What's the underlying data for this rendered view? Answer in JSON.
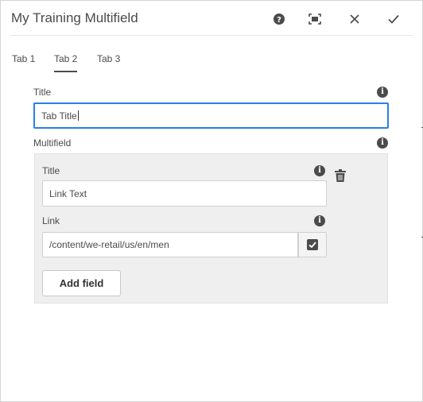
{
  "dialog": {
    "title": "My Training Multifield",
    "buttons": {
      "help": "help-icon",
      "fullscreen": "fullscreen-icon",
      "close": "close-icon",
      "done": "checkmark-icon"
    }
  },
  "tabs": [
    {
      "label": "Tab 1",
      "active": false
    },
    {
      "label": "Tab 2",
      "active": true
    },
    {
      "label": "Tab 3",
      "active": false
    }
  ],
  "form": {
    "title_field": {
      "label": "Title",
      "value": "Tab Title"
    },
    "multifield": {
      "label": "Multifield",
      "item": {
        "title": {
          "label": "Title",
          "value": "Link Text"
        },
        "link": {
          "label": "Link",
          "value": "/content/we-retail/us/en/men"
        }
      },
      "add_label": "Add field"
    }
  },
  "colors": {
    "accent": "#2680eb",
    "text": "#4b4b4b",
    "multifield_bg": "#efefef"
  }
}
